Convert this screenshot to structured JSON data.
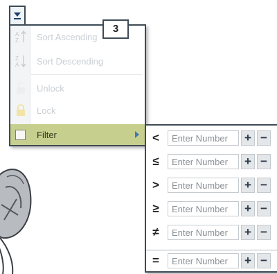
{
  "callout": {
    "number": "3"
  },
  "menu": {
    "items": [
      {
        "label": "Sort Ascending",
        "icon": "sort-ascending-icon",
        "enabled": false
      },
      {
        "label": "Sort Descending",
        "icon": "sort-descending-icon",
        "enabled": false
      },
      {
        "label": "Unlock",
        "icon": "unlock-icon",
        "enabled": false
      },
      {
        "label": "Lock",
        "icon": "lock-icon",
        "enabled": false
      }
    ],
    "filter": {
      "label": "Filter",
      "icon": "checkbox-icon",
      "submenu_icon": "submenu-arrow-icon",
      "highlight_color": "#c7cf8f"
    }
  },
  "filter_submenu": {
    "rows": [
      {
        "operator": "<",
        "placeholder": "Enter Number",
        "plus": "+",
        "minus": "−"
      },
      {
        "operator": "≤",
        "placeholder": "Enter Number",
        "plus": "+",
        "minus": "−"
      },
      {
        "operator": ">",
        "placeholder": "Enter Number",
        "plus": "+",
        "minus": "−"
      },
      {
        "operator": "≥",
        "placeholder": "Enter Number",
        "plus": "+",
        "minus": "−"
      },
      {
        "operator": "≠",
        "placeholder": "Enter Number",
        "plus": "+",
        "minus": "−"
      },
      {
        "operator": "=",
        "placeholder": "Enter Number",
        "plus": "+",
        "minus": "−"
      }
    ]
  }
}
